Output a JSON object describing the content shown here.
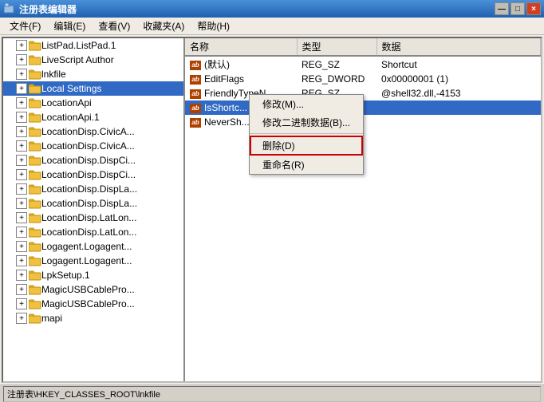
{
  "window": {
    "title": "注册表编辑器",
    "close_btn": "×",
    "min_btn": "—",
    "max_btn": "□"
  },
  "menu": {
    "items": [
      "文件(F)",
      "编辑(E)",
      "查看(V)",
      "收藏夹(A)",
      "帮助(H)"
    ]
  },
  "tree": {
    "items": [
      {
        "label": "ListPad.ListPad.1",
        "indent": 1,
        "expanded": false
      },
      {
        "label": "LiveScript Author",
        "indent": 1,
        "expanded": false
      },
      {
        "label": "lnkfile",
        "indent": 1,
        "expanded": false
      },
      {
        "label": "Local Settings",
        "indent": 1,
        "expanded": false
      },
      {
        "label": "LocationApi",
        "indent": 1,
        "expanded": false
      },
      {
        "label": "LocationApi.1",
        "indent": 1,
        "expanded": false
      },
      {
        "label": "LocationDisp.CivicA...",
        "indent": 1,
        "expanded": false
      },
      {
        "label": "LocationDisp.CivicA...",
        "indent": 1,
        "expanded": false
      },
      {
        "label": "LocationDisp.DispCi...",
        "indent": 1,
        "expanded": false
      },
      {
        "label": "LocationDisp.DispCi...",
        "indent": 1,
        "expanded": false
      },
      {
        "label": "LocationDisp.DispLa...",
        "indent": 1,
        "expanded": false
      },
      {
        "label": "LocationDisp.DispLa...",
        "indent": 1,
        "expanded": false
      },
      {
        "label": "LocationDisp.LatLon...",
        "indent": 1,
        "expanded": false
      },
      {
        "label": "LocationDisp.LatLon...",
        "indent": 1,
        "expanded": false
      },
      {
        "label": "Logagent.Logagent...",
        "indent": 1,
        "expanded": false
      },
      {
        "label": "Logagent.Logagent...",
        "indent": 1,
        "expanded": false
      },
      {
        "label": "LpkSetup.1",
        "indent": 1,
        "expanded": false
      },
      {
        "label": "MagicUSBCablePro...",
        "indent": 1,
        "expanded": false
      },
      {
        "label": "MagicUSBCablePro...",
        "indent": 1,
        "expanded": false
      },
      {
        "label": "mapi",
        "indent": 1,
        "expanded": false
      }
    ]
  },
  "columns": [
    "名称",
    "类型",
    "数据"
  ],
  "table_rows": [
    {
      "name": "(默认)",
      "type": "REG_SZ",
      "data": "Shortcut",
      "icon": "ab"
    },
    {
      "name": "EditFlags",
      "type": "REG_DWORD",
      "data": "0x00000001 (1)",
      "icon": "ab"
    },
    {
      "name": "FriendlyTypeN...",
      "type": "REG_SZ",
      "data": "@shell32.dll,-4153",
      "icon": "ab"
    },
    {
      "name": "IsShortc...",
      "type": "",
      "data": "",
      "icon": "ab",
      "selected": true
    },
    {
      "name": "NeverSh...",
      "type": "",
      "data": "",
      "icon": "ab"
    }
  ],
  "context_menu": {
    "items": [
      {
        "label": "修改(M)...",
        "type": "normal"
      },
      {
        "label": "修改二进制数据(B)...",
        "type": "normal"
      },
      {
        "label": "separator"
      },
      {
        "label": "删除(D)",
        "type": "delete"
      },
      {
        "label": "重命名(R)",
        "type": "normal"
      }
    ]
  },
  "status_bar": {
    "text": "注册表\\HKEY_CLASSES_ROOT\\lnkfile"
  }
}
